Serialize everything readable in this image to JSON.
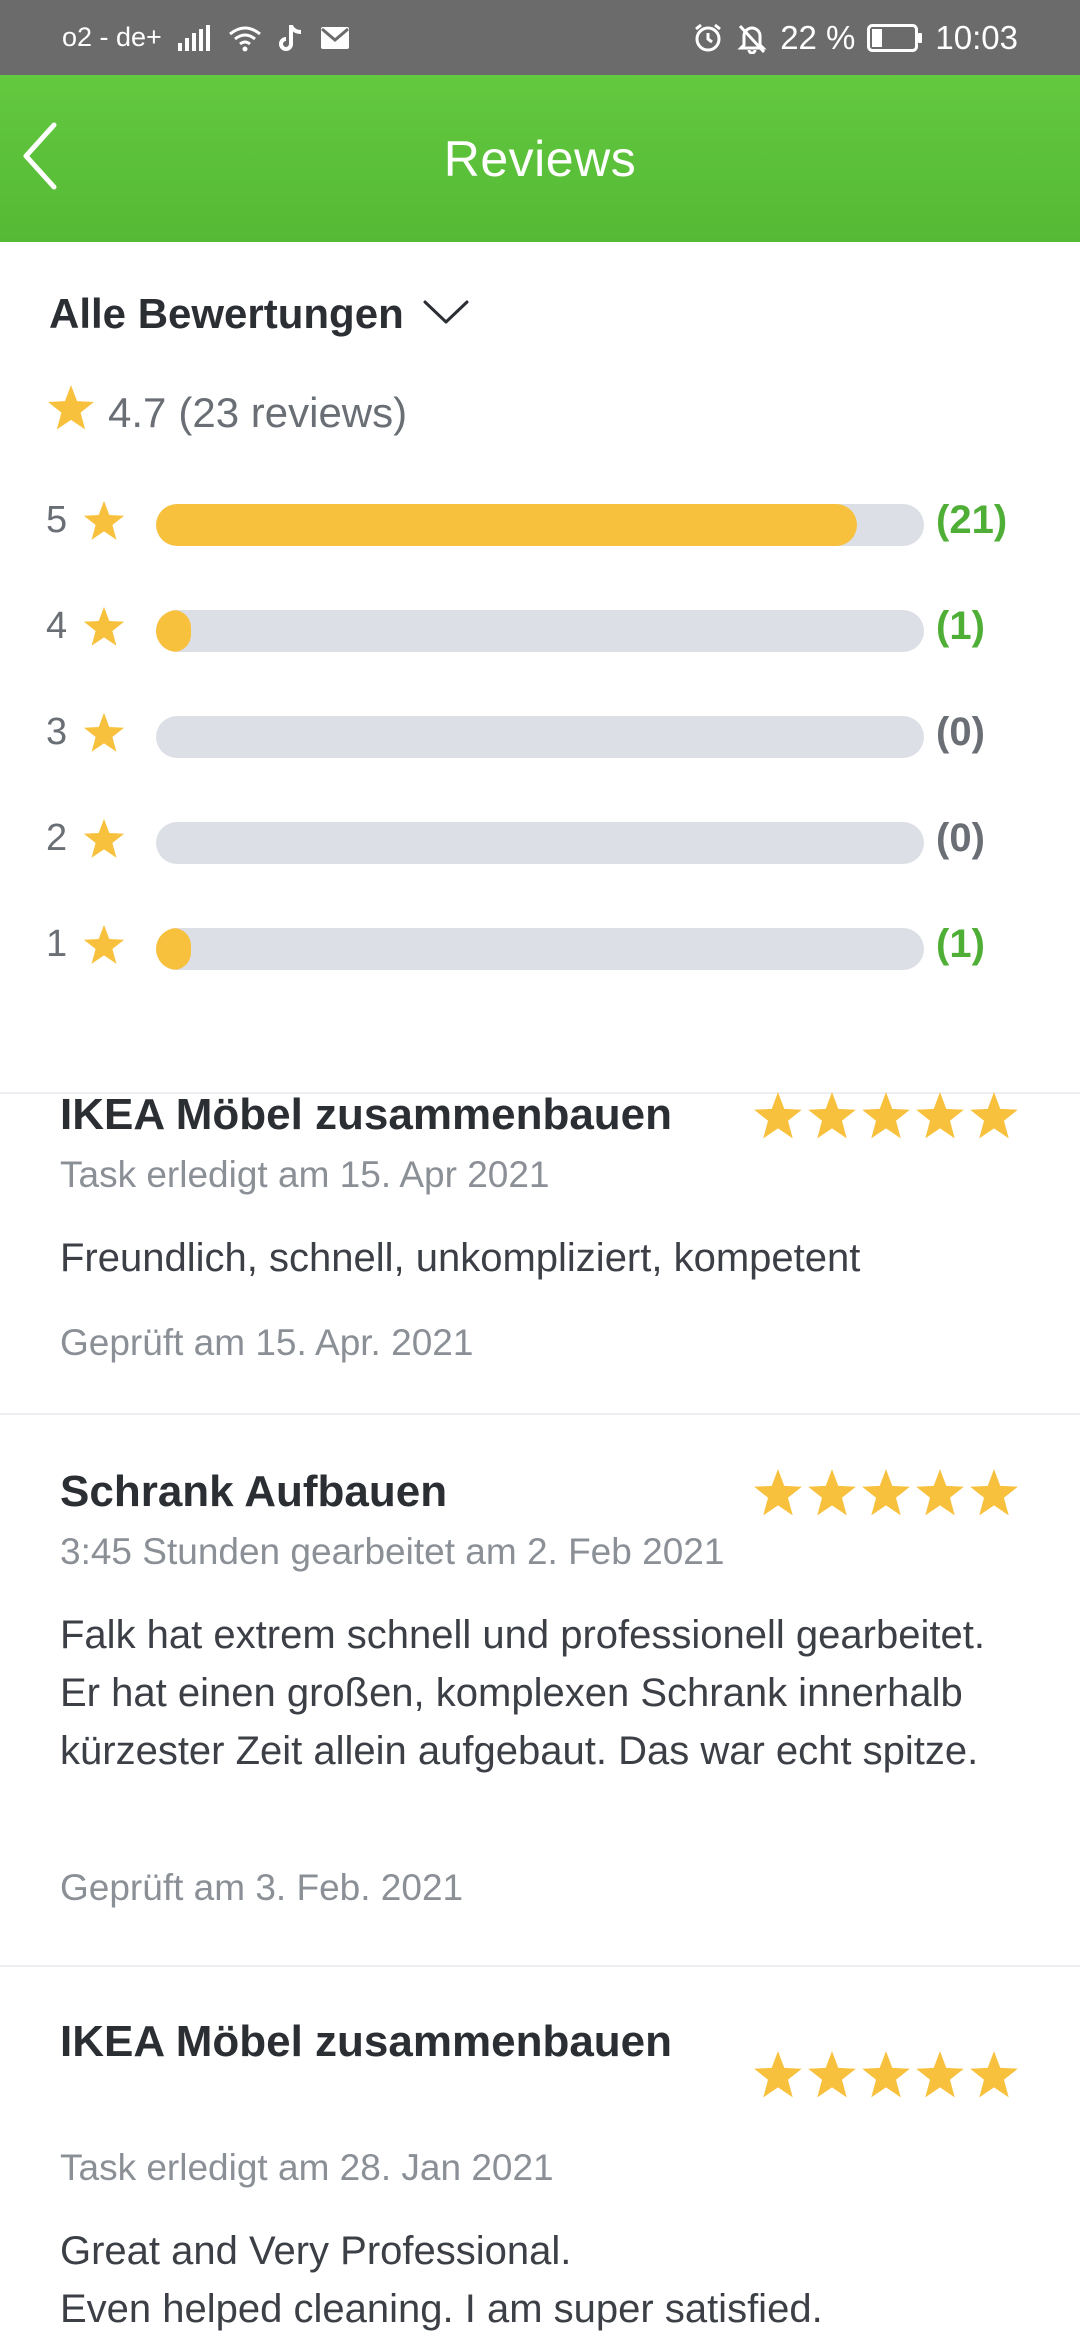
{
  "status_bar": {
    "carrier": "o2 - de+",
    "battery": "22 %",
    "time": "10:03",
    "icons": [
      "signal-icon",
      "wifi-icon",
      "tiktok-icon",
      "mail-icon",
      "alarm-icon",
      "bell-off-icon",
      "battery-icon"
    ]
  },
  "header": {
    "title": "Reviews",
    "back_icon": "chevron-left-icon",
    "color": "#5cc13a"
  },
  "filter": {
    "label": "Alle Bewertungen",
    "icon": "chevron-down-icon"
  },
  "summary": {
    "rating": "4.7",
    "count_text": "(23 reviews)",
    "star_color": "#f8c13d"
  },
  "distribution": [
    {
      "stars": "5",
      "count": "(21)",
      "value": 21,
      "fill_fraction": 0.913
    },
    {
      "stars": "4",
      "count": "(1)",
      "value": 1,
      "fill_fraction": 0.043
    },
    {
      "stars": "3",
      "count": "(0)",
      "value": 0,
      "fill_fraction": 0
    },
    {
      "stars": "2",
      "count": "(0)",
      "value": 0,
      "fill_fraction": 0
    },
    {
      "stars": "1",
      "count": "(1)",
      "value": 1,
      "fill_fraction": 0.043
    }
  ],
  "reviews": [
    {
      "title": "IKEA Möbel zusammenbauen",
      "subtitle": "Task erledigt am 15. Apr 2021",
      "body": "Freundlich, schnell, unkompliziert, kompetent",
      "verified": "Geprüft am 15. Apr. 2021",
      "stars": 5
    },
    {
      "title": "Schrank Aufbauen",
      "subtitle": "3:45 Stunden gearbeitet am 2. Feb 2021",
      "body": "Falk hat extrem schnell und professionell gearbeitet. Er hat einen großen, komplexen Schrank innerhalb kürzester Zeit allein aufgebaut. Das war echt spitze.",
      "verified": "Geprüft am 3. Feb. 2021",
      "stars": 5
    },
    {
      "title": "IKEA Möbel zusammenbauen",
      "subtitle": "Task erledigt am 28. Jan 2021",
      "body_lines": [
        "Great and Very Professional.",
        "Even helped cleaning. I am super satisfied."
      ],
      "stars": 5
    }
  ]
}
